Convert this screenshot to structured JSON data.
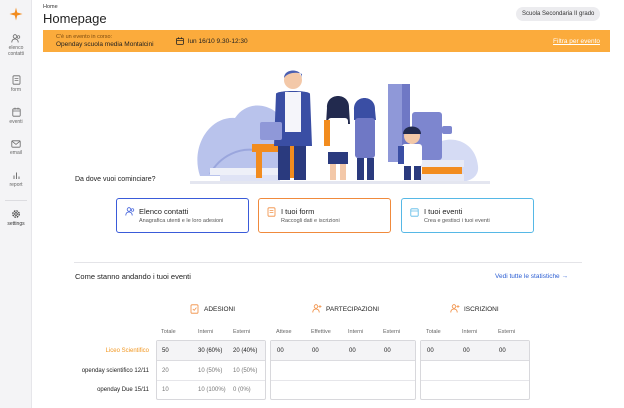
{
  "sidebar": {
    "items": [
      {
        "icon": "users-icon",
        "label": "elenco contatti"
      },
      {
        "icon": "form-icon",
        "label": "form"
      },
      {
        "icon": "calendar-icon",
        "label": "eventi"
      },
      {
        "icon": "mail-icon",
        "label": "email"
      },
      {
        "icon": "bar-chart-icon",
        "label": "report"
      },
      {
        "icon": "gear-icon",
        "label": "settings"
      }
    ]
  },
  "header": {
    "breadcrumb": "Home",
    "title": "Homepage",
    "school": "Scuola Secondaria II grado"
  },
  "banner": {
    "kicker": "C'è un evento in corso:",
    "event": "Openday scuola media Montalcini",
    "date": "lun 16/10 9.30-12:30",
    "filter_link": "Filtra per evento",
    "color": "#fbab3c"
  },
  "start": {
    "question": "Da dove vuoi cominciare?",
    "cards": [
      {
        "title": "Elenco contatti",
        "desc": "Anagrafica utenti e le loro adesioni",
        "color": "#3a5bd9"
      },
      {
        "title": "I tuoi form",
        "desc": "Raccogli dati e iscrizioni",
        "color": "#f08a3c"
      },
      {
        "title": "I tuoi eventi",
        "desc": "Crea e gestisci i tuoi eventi",
        "color": "#56b8e6"
      }
    ]
  },
  "stats": {
    "title": "Come stanno andando i tuoi eventi",
    "link": "Vedi tutte le statistiche →",
    "rows": [
      "Liceo Scientifico",
      "openday scientifico 12/11",
      "openday Due 15/11"
    ],
    "groups": [
      {
        "name": "ADESIONI",
        "columns": [
          "Totale",
          "Interni",
          "Esterni"
        ],
        "cells": [
          [
            "50",
            "30 (60%)",
            "20 (40%)"
          ],
          [
            "20",
            "10 (50%)",
            "10 (50%)"
          ],
          [
            "10",
            "10 (100%)",
            "0 (0%)"
          ]
        ]
      },
      {
        "name": "PARTECIPAZIONI",
        "columns": [
          "Attese",
          "Effettive",
          "Interni",
          "Esterni"
        ],
        "cells": [
          [
            "00",
            "00",
            "00",
            "00"
          ],
          [
            "",
            "",
            "",
            ""
          ],
          [
            "",
            "",
            "",
            ""
          ]
        ]
      },
      {
        "name": "ISCRIZIONI",
        "columns": [
          "Totale",
          "Interni",
          "Esterni"
        ],
        "cells": [
          [
            "00",
            "00",
            "00"
          ],
          [
            "",
            "",
            ""
          ],
          [
            "",
            "",
            ""
          ]
        ]
      }
    ]
  }
}
